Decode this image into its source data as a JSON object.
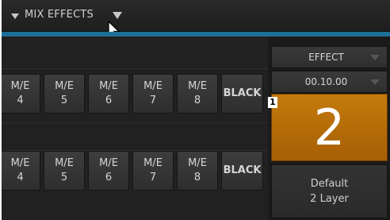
{
  "header": {
    "title": "MIX EFFECTS"
  },
  "row1": [
    {
      "line1": "M/E",
      "line2": "4"
    },
    {
      "line1": "M/E",
      "line2": "5"
    },
    {
      "line1": "M/E",
      "line2": "6"
    },
    {
      "line1": "M/E",
      "line2": "7"
    },
    {
      "line1": "M/E",
      "line2": "8"
    }
  ],
  "row1_black": "BLACK",
  "row2": [
    {
      "line1": "M/E",
      "line2": "4"
    },
    {
      "line1": "M/E",
      "line2": "5"
    },
    {
      "line1": "M/E",
      "line2": "6"
    },
    {
      "line1": "M/E",
      "line2": "7"
    },
    {
      "line1": "M/E",
      "line2": "8"
    }
  ],
  "row2_black": "BLACK",
  "effect": {
    "label": "EFFECT"
  },
  "duration": {
    "label": "00.10.00"
  },
  "selected": {
    "number": "2",
    "badge": "1"
  },
  "preset": {
    "line1": "Default",
    "line2": "2 Layer"
  },
  "colors": {
    "accent": "#1e6f98",
    "selected": "#b86d08"
  }
}
